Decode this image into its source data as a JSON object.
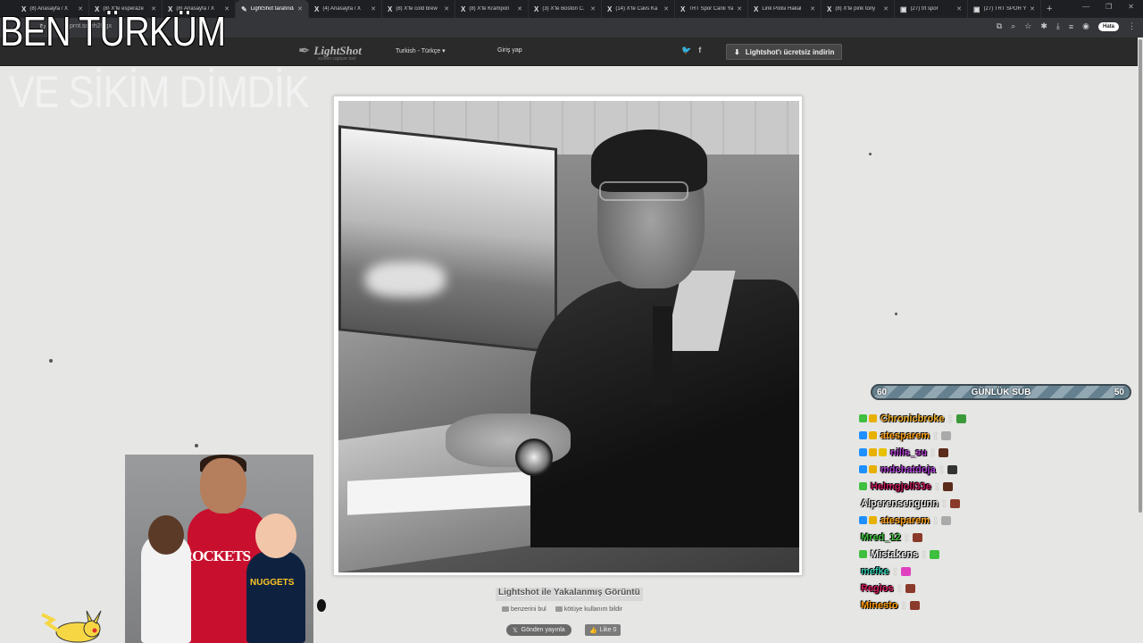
{
  "browser": {
    "tabs": [
      {
        "icon": "X",
        "label": "(8) Anasayfa / X",
        "active": false
      },
      {
        "icon": "X",
        "label": "(8) X'te esperaze",
        "active": false
      },
      {
        "icon": "X",
        "label": "(8) Anasayfa / X",
        "active": false
      },
      {
        "icon": "✎",
        "label": "LightShot tarafından",
        "active": true
      },
      {
        "icon": "X",
        "label": "(4) Anasayfa / X",
        "active": false
      },
      {
        "icon": "X",
        "label": "(8) X'te cold brew",
        "active": false
      },
      {
        "icon": "X",
        "label": "(8) X'te Krampon",
        "active": false
      },
      {
        "icon": "X",
        "label": "(3) X'te Boston C.",
        "active": false
      },
      {
        "icon": "X",
        "label": "(14) X'te Cavs Ka",
        "active": false
      },
      {
        "icon": "X",
        "label": "TRT Spor Canlı Ya",
        "active": false
      },
      {
        "icon": "X",
        "label": "Link Polisi Hakal",
        "active": false
      },
      {
        "icon": "X",
        "label": "(8) X'te pink tony",
        "active": false
      },
      {
        "icon": "▣",
        "label": "(27) trt spor",
        "active": false
      },
      {
        "icon": "▣",
        "label": "(27) TRT SPOR Y",
        "active": false
      }
    ],
    "newtab": "+",
    "url": "prnt.sc/eh2Hgx",
    "profile": "Hata"
  },
  "lightshot": {
    "logo": "LightShot",
    "logo_sub": "screen capture tool",
    "language": "Turkish - Türkçe",
    "login": "Giriş yap",
    "download": "Lightshot'ı ücretsiz indirin",
    "caption_title": "Lightshot ile Yakalanmış Görüntü",
    "find_similar": "benzerini bul",
    "report_abuse": "kötüye kullanım bildir",
    "tweet": "Gönden yayınla",
    "like": "Like 0"
  },
  "overlay": {
    "line1": "BEN TÜRKÜM",
    "line2": "VE SİKİM DİMDİK"
  },
  "subgoal": {
    "current": "60",
    "label": "GÜNLÜK SUB",
    "goal": "50"
  },
  "chat": [
    {
      "user": "Chronicbroke",
      "color": "#f0b030",
      "badges": [
        "#3fbf3f",
        "#e8b000"
      ],
      "emote": "#3a9a3a"
    },
    {
      "user": "atesparem",
      "color": "#ffa31a",
      "badges": [
        "#1e90ff",
        "#e8b000"
      ],
      "emote": "#aaaaaa"
    },
    {
      "user": "nills_su",
      "color": "#b23fd1",
      "badges": [
        "#1e90ff",
        "#e8b000",
        "#e8c000"
      ],
      "emote": "#5a2a1a"
    },
    {
      "user": "mdchatdoja",
      "color": "#a83fd1",
      "badges": [
        "#1e90ff",
        "#e8b000"
      ],
      "emote": "#333333"
    },
    {
      "user": "Helmgjoll33e",
      "color": "#c2185b",
      "badges": [
        "#3fbf3f"
      ],
      "emote": "#5a2a1a"
    },
    {
      "user": "Alperensengunn",
      "color": "#e8e8e8",
      "badges": [],
      "emote": "#8a3a2a"
    },
    {
      "user": "atesparem",
      "color": "#ffa31a",
      "badges": [
        "#1e90ff",
        "#e8b000"
      ],
      "emote": "#aaaaaa"
    },
    {
      "user": "Mred_12",
      "color": "#3fbf3f",
      "badges": [],
      "emote": "#8a3a2a"
    },
    {
      "user": "Mistakens",
      "color": "#f0f0f0",
      "badges": [
        "#3fbf3f"
      ],
      "emote": "#3fbf3f"
    },
    {
      "user": "mefke",
      "color": "#2ec4a8",
      "badges": [],
      "emote": "#e040c0"
    },
    {
      "user": "Regios",
      "color": "#d81b60",
      "badges": [],
      "emote": "#8a3a2a"
    },
    {
      "user": "Minesto",
      "color": "#ff9800",
      "badges": [],
      "emote": "#8a3a2a"
    }
  ],
  "inset": {
    "jersey": "ROCKETS",
    "kid_jersey": "NUGGETS"
  },
  "colors": {
    "page_bg": "#e6e6e4",
    "header_bg": "#2a2a2a",
    "tabstrip_bg": "#1e1f22"
  }
}
